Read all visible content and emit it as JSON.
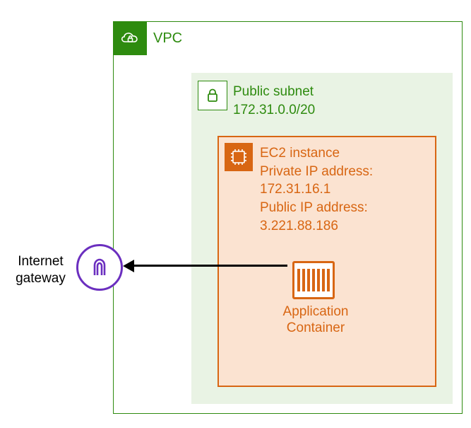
{
  "vpc": {
    "label": "VPC"
  },
  "subnet": {
    "label": "Public subnet",
    "cidr": "172.31.0.0/20"
  },
  "ec2": {
    "label": "EC2 instance",
    "priv_label": "Private IP address:",
    "priv_ip": "172.31.16.1",
    "pub_label": "Public IP address:",
    "pub_ip": "3.221.88.186"
  },
  "container": {
    "label_line1": "Application",
    "label_line2": "Container"
  },
  "igw": {
    "label_line1": "Internet",
    "label_line2": "gateway"
  }
}
